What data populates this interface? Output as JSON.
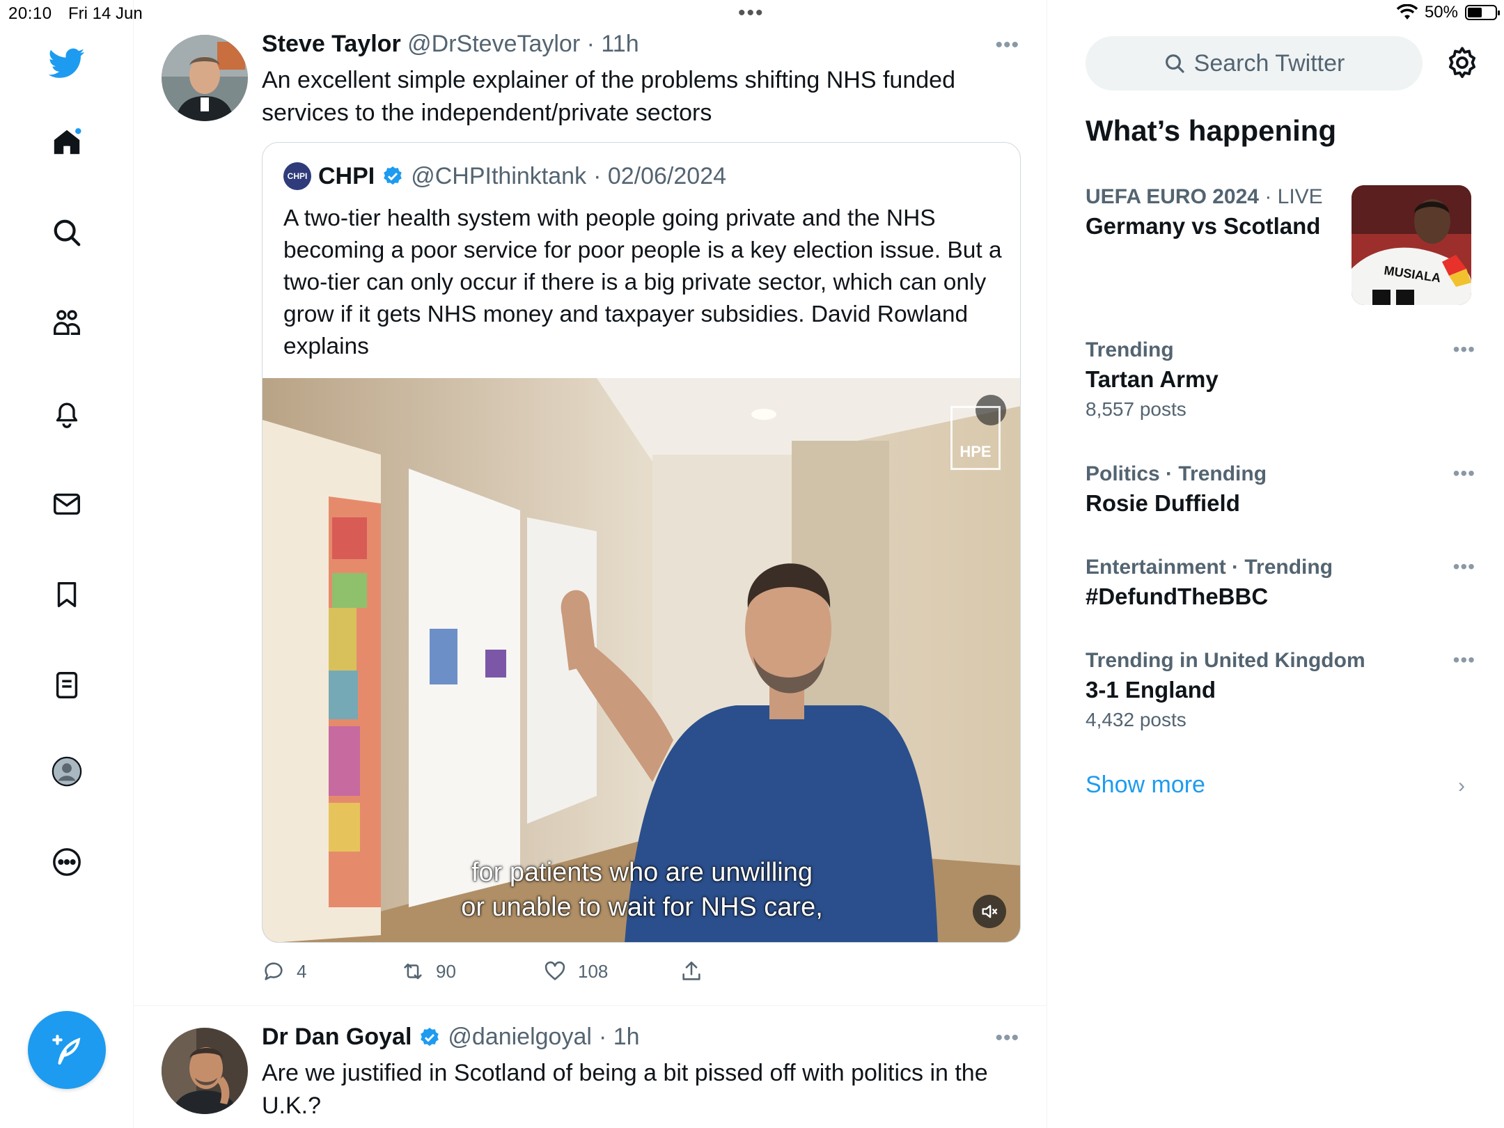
{
  "status_bar": {
    "time": "20:10",
    "date": "Fri 14 Jun",
    "battery": "50%",
    "battery_level": 0.5,
    "center_dots": "•••"
  },
  "nav": {
    "items": [
      "home",
      "explore",
      "communities",
      "notifications",
      "messages",
      "bookmarks",
      "lists",
      "profile",
      "more"
    ],
    "accent_color": "#1d9bf0"
  },
  "tweets": [
    {
      "name": "Steve Taylor",
      "handle": "@DrSteveTaylor",
      "time": "· 11h",
      "more": "•••",
      "text": "An excellent simple explainer of the problems shifting NHS funded services to the independent/private sectors",
      "quote": {
        "logo_text": "CHPI",
        "name": "CHPI",
        "handle": "@CHPIthinktank",
        "time": "· 02/06/2024",
        "text": "A two-tier health system with people going private and the NHS becoming a poor service for poor people is a key election issue. But a two-tier can only occur if there is a big private sector, which can only grow if it gets NHS money and taxpayer subsidies. David Rowland explains",
        "video": {
          "caption_line1": "for patients who are unwilling",
          "caption_line2": "or unable to wait for NHS care,",
          "watermark": "HPE"
        }
      },
      "actions": {
        "replies": "4",
        "retweets": "90",
        "likes": "108"
      }
    },
    {
      "name": "Dr Dan Goyal",
      "handle": "@danielgoyal",
      "time": "· 1h",
      "more": "•••",
      "text": "Are we justified in Scotland of being a bit pissed off with politics in the U.K.?"
    }
  ],
  "sidebar": {
    "search_placeholder": "Search Twitter",
    "title": "What’s happening",
    "trends": [
      {
        "meta_a": "UEFA EURO 2024",
        "meta_b": "· LIVE",
        "name": "Germany vs Scotland",
        "count": ""
      },
      {
        "meta_a": "Trending",
        "meta_b": "",
        "name": "Tartan Army",
        "count": "8,557 posts"
      },
      {
        "meta_a": "Politics",
        "meta_b": "· Trending",
        "name": "Rosie Duffield",
        "count": ""
      },
      {
        "meta_a": "Entertainment",
        "meta_b": "· Trending",
        "name": "#DefundTheBBC",
        "count": ""
      },
      {
        "meta_a": "Trending in United Kingdom",
        "meta_b": "",
        "name": "3-1 England",
        "count": "4,432 posts"
      }
    ],
    "euro_image_text": "MUSIALA",
    "more": "•••",
    "show_more": "Show more",
    "chevron": "›"
  }
}
